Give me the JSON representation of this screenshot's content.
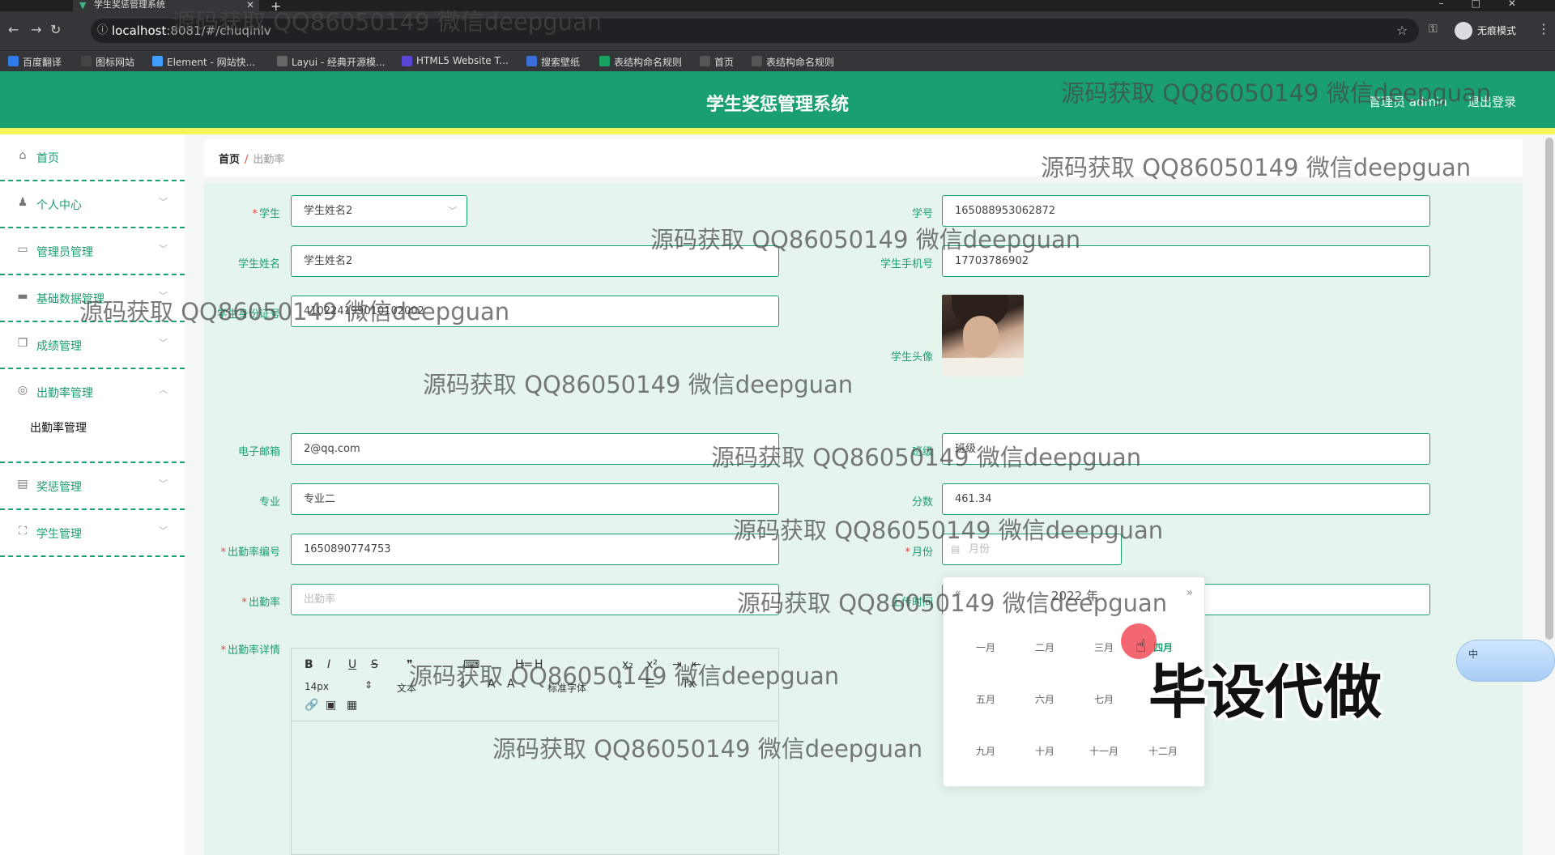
{
  "browser": {
    "tab_title": "学生奖惩管理系统",
    "url_host": "localhost",
    "url_path": ":8081/#/chuqinlv",
    "incognito_label": "无痕模式",
    "bookmarks": [
      {
        "label": "百度翻译",
        "icon": "translate-icon",
        "color": "#2f7bea"
      },
      {
        "label": "图标网站",
        "icon": "flag-icon",
        "color": "#444"
      },
      {
        "label": "Element - 网站快...",
        "icon": "element-icon",
        "color": "#409eff"
      },
      {
        "label": "Layui - 经典开源模...",
        "icon": "layui-icon",
        "color": "#666"
      },
      {
        "label": "HTML5 Website T...",
        "icon": "html5-icon",
        "color": "#5a46d6"
      },
      {
        "label": "搜索壁纸",
        "icon": "wallpaper-icon",
        "color": "#3b6fd9"
      },
      {
        "label": "表结构命名规则",
        "icon": "sheet-icon",
        "color": "#1aa260"
      },
      {
        "label": "首页",
        "icon": "globe-icon",
        "color": "#555"
      },
      {
        "label": "表结构命名规则",
        "icon": "globe-icon",
        "color": "#555"
      }
    ]
  },
  "header": {
    "title": "学生奖惩管理系统",
    "user": "管理员 admin",
    "logout": "退出登录"
  },
  "sidebar": {
    "items": [
      {
        "label": "首页",
        "icon": "home-icon"
      },
      {
        "label": "个人中心",
        "icon": "user-icon"
      },
      {
        "label": "管理员管理",
        "icon": "chat-icon"
      },
      {
        "label": "基础数据管理",
        "icon": "message-icon"
      },
      {
        "label": "成绩管理",
        "icon": "copy-icon"
      },
      {
        "label": "出勤率管理",
        "icon": "target-icon"
      },
      {
        "label": "奖惩管理",
        "icon": "print-icon"
      },
      {
        "label": "学生管理",
        "icon": "fullscreen-icon"
      }
    ],
    "sub_item": "出勤率管理"
  },
  "breadcrumb": {
    "home": "首页",
    "separator": "/",
    "current": "出勤率"
  },
  "form": {
    "student_label": "学生",
    "student_value": "学生姓名2",
    "xuehao_label": "学号",
    "xuehao_value": "165088953062872",
    "name_label": "学生姓名",
    "name_value": "学生姓名2",
    "phone_label": "学生手机号",
    "phone_value": "17703786902",
    "idcard_label": "学生身份证号",
    "idcard_value": "410224199010102002",
    "avatar_label": "学生头像",
    "email_label": "电子邮箱",
    "email_value": "2@qq.com",
    "class_label": "班级",
    "class_value": "班级",
    "major_label": "专业",
    "major_value": "专业二",
    "score_label": "分数",
    "score_value": "461.34",
    "code_label": "出勤率编号",
    "code_value": "1650890774753",
    "month_label": "月份",
    "month_placeholder": "月份",
    "rate_label": "出勤率",
    "rate_placeholder": "出勤率",
    "other_label": "上传时间",
    "detail_label": "出勤率详情"
  },
  "editor": {
    "font_size": "14px",
    "text_style": "文本",
    "font_family": "标准字体"
  },
  "picker": {
    "year": "2022 年",
    "months": [
      "一月",
      "二月",
      "三月",
      "四月",
      "五月",
      "六月",
      "七月",
      "八月",
      "九月",
      "十月",
      "十一月",
      "十二月"
    ],
    "current_index": 3
  },
  "overlay": {
    "watermark": "源码获取 QQ86050149 微信deepguan",
    "big_text": "毕设代做",
    "ime": "中"
  },
  "colors": {
    "primary": "#1a9f72",
    "accent_bar": "#f5f45a",
    "required": "#e04747"
  }
}
